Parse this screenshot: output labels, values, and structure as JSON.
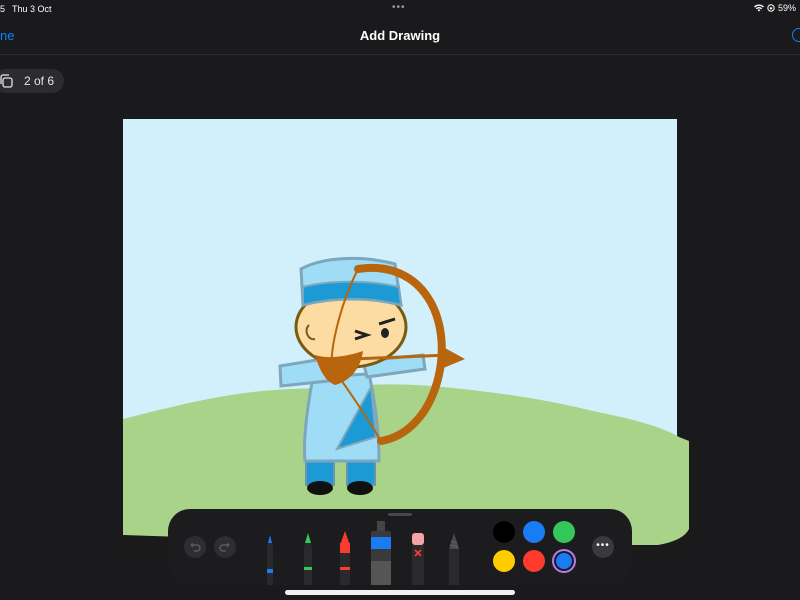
{
  "status_bar": {
    "time": "5",
    "date": "Thu 3 Oct",
    "battery": "59%"
  },
  "header": {
    "left_label": "ne",
    "title": "Add Drawing"
  },
  "page_indicator": "2 of 6",
  "toolbar": {
    "tools": [
      "pen",
      "marker",
      "crayon",
      "fountain-pen",
      "eraser",
      "pencil"
    ],
    "colors": [
      "#000000",
      "#1a7cf5",
      "#34c759",
      "#ffcc00",
      "#ff3b30",
      "#1a7cf5"
    ],
    "selected_color_index": 5
  },
  "colors": {
    "accent": "#0a84ff",
    "canvas_sky": "#d2f0fb",
    "hill": "#a9d389",
    "robe": "#9fdcf5",
    "bow": "#b8650e"
  }
}
